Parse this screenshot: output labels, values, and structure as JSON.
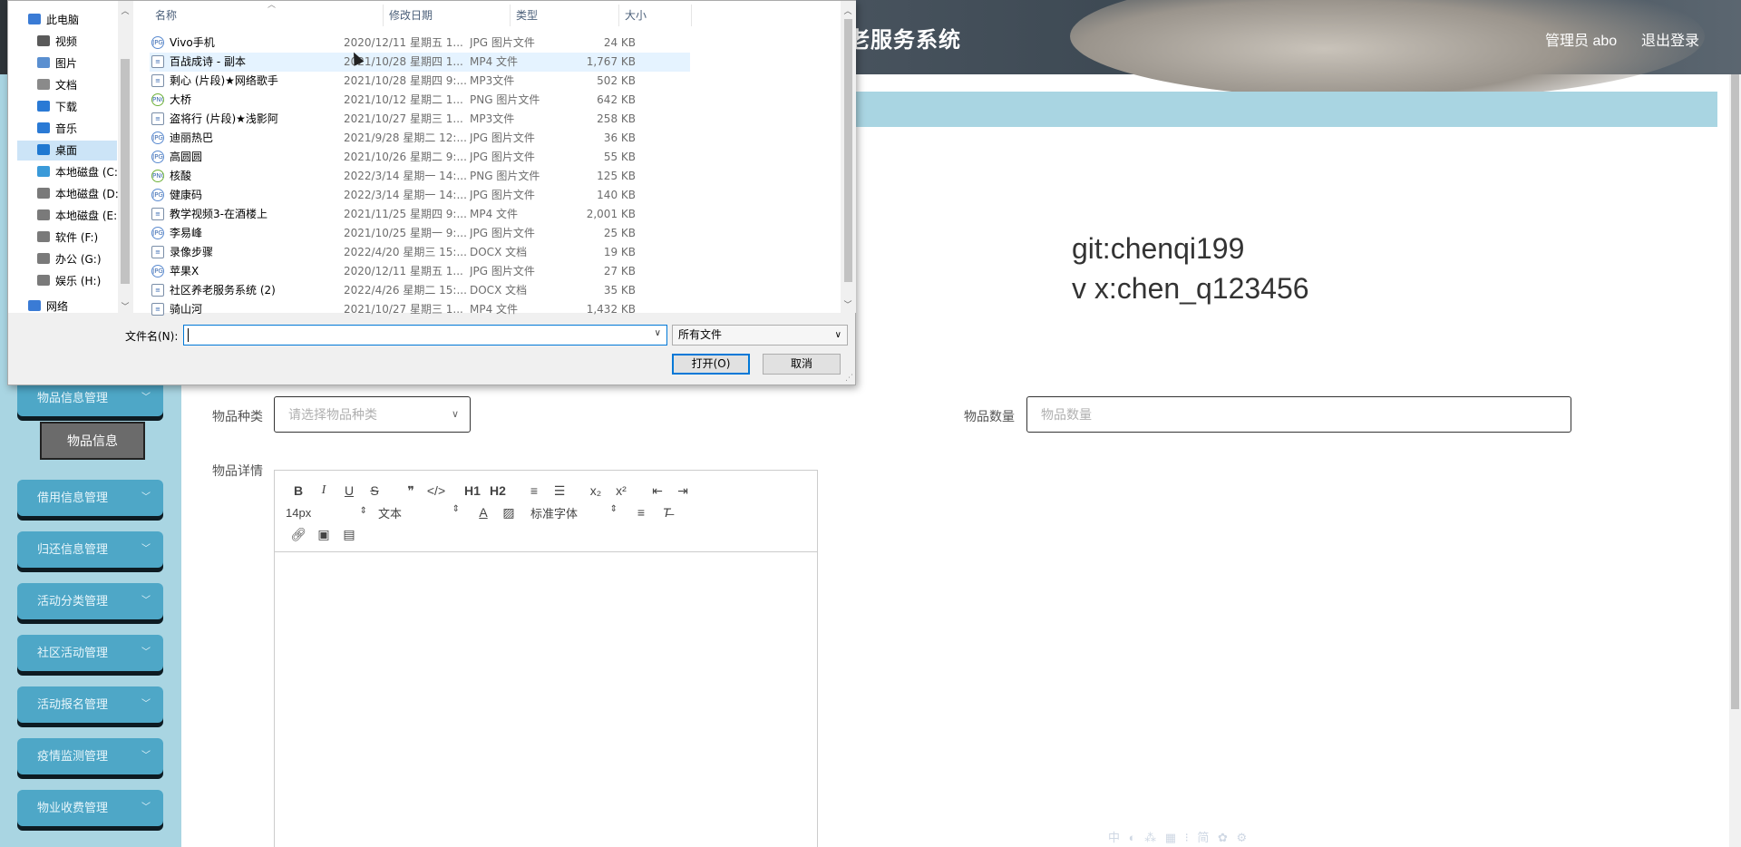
{
  "app": {
    "title": "社区养老服务系统",
    "title_visible": "老服务系统",
    "admin_label": "管理员 abo",
    "logout_label": "退出登录",
    "contact_line1": "git:chenqi199",
    "contact_line2": "v x:chen_q123456"
  },
  "sidebar": {
    "menus": [
      {
        "label": "物品信息管理"
      },
      {
        "label": "借用信息管理"
      },
      {
        "label": "归还信息管理"
      },
      {
        "label": "活动分类管理"
      },
      {
        "label": "社区活动管理"
      },
      {
        "label": "活动报名管理"
      },
      {
        "label": "疫情监测管理"
      },
      {
        "label": "物业收费管理"
      }
    ],
    "active_sub_item": "物品信息",
    "chevron_icon": "chevron-down-icon"
  },
  "form": {
    "category_label": "物品种类",
    "category_placeholder": "请选择物品种类",
    "quantity_label": "物品数量",
    "quantity_placeholder": "物品数量",
    "details_label": "物品详情",
    "editor": {
      "font_size": "14px",
      "paragraph": "文本",
      "font_family": "标准字体",
      "buttons_row1": [
        "B",
        "I",
        "U",
        "S",
        "❞",
        "</>",
        "H1",
        "H2",
        "≡",
        "☰",
        "x₂",
        "x²",
        "⇤",
        "⇥"
      ],
      "icons_row3": [
        "link-icon",
        "image-icon",
        "video-icon"
      ]
    }
  },
  "dialog": {
    "nav": [
      {
        "label": "此电脑",
        "icon": "computer-icon",
        "color": "#3a7bd5"
      },
      {
        "label": "视频",
        "icon": "video-folder-icon",
        "color": "#5a5a5a"
      },
      {
        "label": "图片",
        "icon": "pictures-folder-icon",
        "color": "#5a8fd0"
      },
      {
        "label": "文档",
        "icon": "documents-folder-icon",
        "color": "#8a8a8a"
      },
      {
        "label": "下载",
        "icon": "download-icon",
        "color": "#2a7ad5"
      },
      {
        "label": "音乐",
        "icon": "music-icon",
        "color": "#2a7ad5"
      },
      {
        "label": "桌面",
        "icon": "desktop-icon",
        "color": "#1f78d1"
      },
      {
        "label": "本地磁盘 (C:",
        "icon": "drive-icon",
        "color": "#3a9ad9"
      },
      {
        "label": "本地磁盘 (D:",
        "icon": "drive-icon",
        "color": "#7a7a7a"
      },
      {
        "label": "本地磁盘 (E:",
        "icon": "drive-icon",
        "color": "#7a7a7a"
      },
      {
        "label": "软件 (F:)",
        "icon": "drive-icon",
        "color": "#7a7a7a"
      },
      {
        "label": "办公 (G:)",
        "icon": "drive-icon",
        "color": "#7a7a7a"
      },
      {
        "label": "娱乐 (H:)",
        "icon": "drive-icon",
        "color": "#7a7a7a"
      },
      {
        "label": "网络",
        "icon": "network-icon",
        "color": "#3a7bd5"
      }
    ],
    "columns": [
      "名称",
      "修改日期",
      "类型",
      "大小"
    ],
    "files": [
      {
        "name": "Vivo手机",
        "date": "2020/12/11 星期五 1...",
        "type": "JPG 图片文件",
        "size": "24 KB",
        "kind": "img"
      },
      {
        "name": "百战成诗 - 副本",
        "date": "2021/10/28 星期四 1...",
        "type": "MP4 文件",
        "size": "1,767 KB",
        "kind": "doc"
      },
      {
        "name": "剩心 (片段)★网络歌手",
        "date": "2021/10/28 星期四 9:...",
        "type": "MP3文件",
        "size": "502 KB",
        "kind": "doc"
      },
      {
        "name": "大桥",
        "date": "2021/10/12 星期二 1...",
        "type": "PNG 图片文件",
        "size": "642 KB",
        "kind": "png"
      },
      {
        "name": "盗将行 (片段)★浅影阿",
        "date": "2021/10/27 星期三 1...",
        "type": "MP3文件",
        "size": "258 KB",
        "kind": "doc"
      },
      {
        "name": "迪丽热巴",
        "date": "2021/9/28 星期二 12:...",
        "type": "JPG 图片文件",
        "size": "36 KB",
        "kind": "img"
      },
      {
        "name": "高圆圆",
        "date": "2021/10/26 星期二 9:...",
        "type": "JPG 图片文件",
        "size": "55 KB",
        "kind": "img"
      },
      {
        "name": "核酸",
        "date": "2022/3/14 星期一 14:...",
        "type": "PNG 图片文件",
        "size": "125 KB",
        "kind": "png"
      },
      {
        "name": "健康码",
        "date": "2022/3/14 星期一 14:...",
        "type": "JPG 图片文件",
        "size": "140 KB",
        "kind": "img"
      },
      {
        "name": "教学视频3-在酒楼上",
        "date": "2021/11/25 星期四 9:...",
        "type": "MP4 文件",
        "size": "2,001 KB",
        "kind": "doc"
      },
      {
        "name": "李易峰",
        "date": "2021/10/25 星期一 9:...",
        "type": "JPG 图片文件",
        "size": "25 KB",
        "kind": "img"
      },
      {
        "name": "录像步骤",
        "date": "2022/4/20 星期三 15:...",
        "type": "DOCX 文档",
        "size": "19 KB",
        "kind": "doc"
      },
      {
        "name": "苹果X",
        "date": "2020/12/11 星期五 1...",
        "type": "JPG 图片文件",
        "size": "27 KB",
        "kind": "img"
      },
      {
        "name": "社区养老服务系统 (2)",
        "date": "2022/4/26 星期二 15:...",
        "type": "DOCX 文档",
        "size": "35 KB",
        "kind": "doc"
      },
      {
        "name": "骑山河",
        "date": "2021/10/27 星期三 1...",
        "type": "MP4 文件",
        "size": "1,432 KB",
        "kind": "doc"
      }
    ],
    "filename_label": "文件名(N):",
    "filename_value": "",
    "filetype_value": "所有文件",
    "open_label": "打开(O)",
    "cancel_label": "取消"
  },
  "ime_toolbar": "中 ◐ ⁂ ▦ ⁝ 简 ✿ ⚙"
}
